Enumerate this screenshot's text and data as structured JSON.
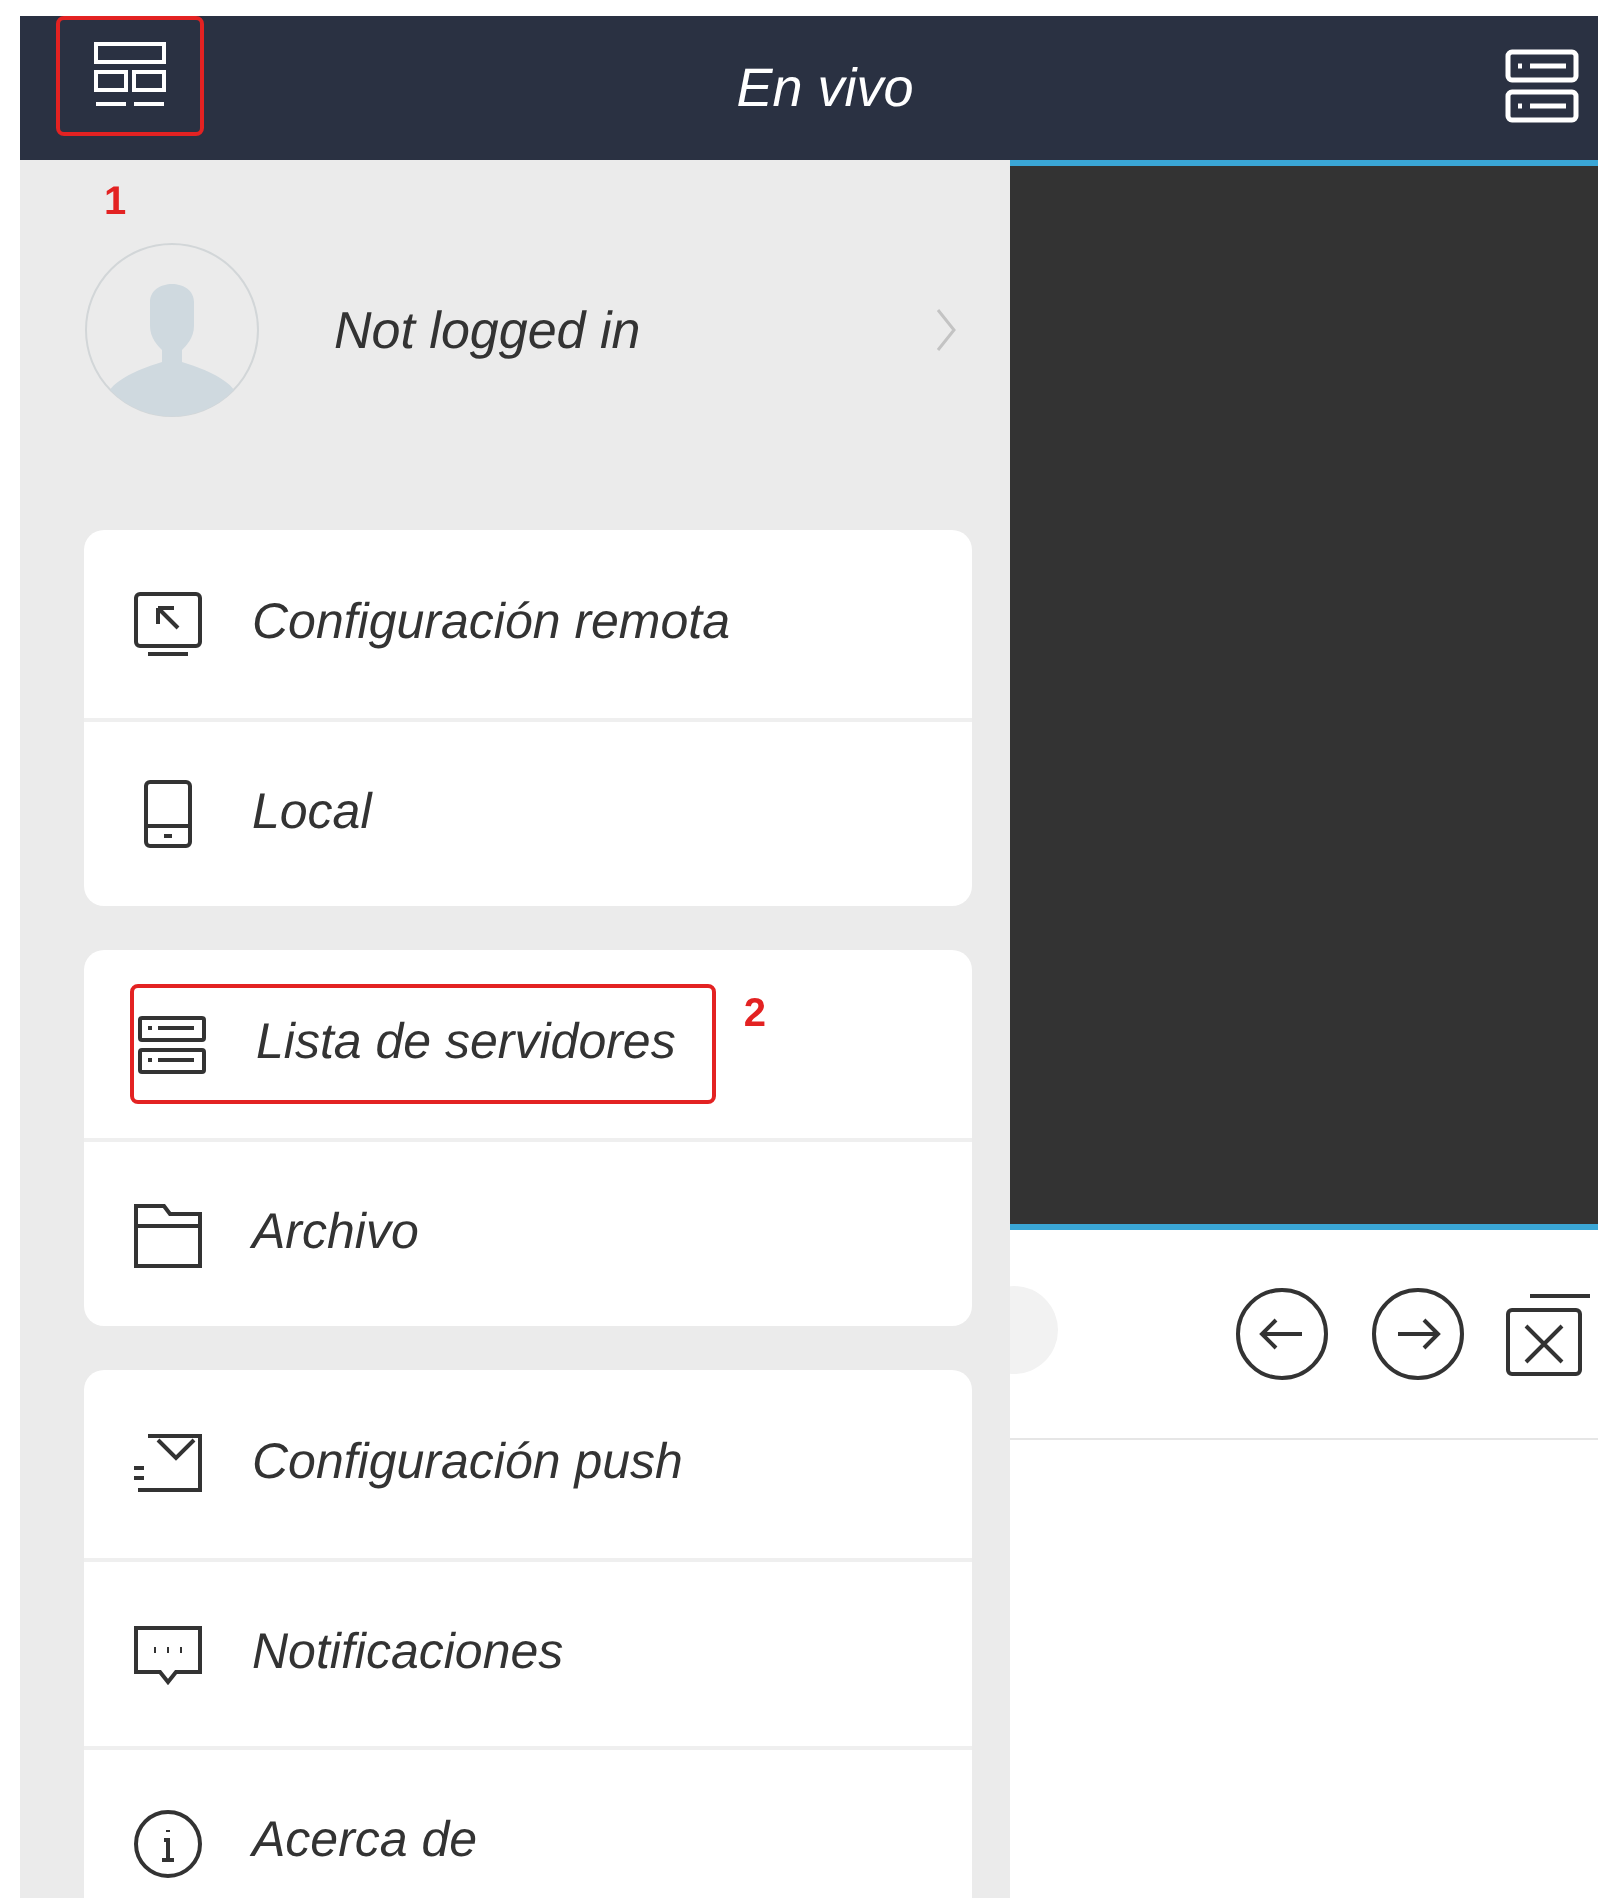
{
  "top_bar": {
    "title": "En vivo",
    "annotation": "1"
  },
  "profile": {
    "name": "Not logged in"
  },
  "menu_groups": [
    {
      "items": [
        {
          "kind": "remote",
          "label": "Configuración remota"
        },
        {
          "kind": "local",
          "label": "Local"
        }
      ]
    },
    {
      "items": [
        {
          "kind": "servers",
          "label": "Lista de servidores",
          "annotation": "2"
        },
        {
          "kind": "files",
          "label": "Archivo"
        }
      ]
    },
    {
      "items": [
        {
          "kind": "push",
          "label": "Configuración push"
        },
        {
          "kind": "messages",
          "label": "Notificaciones"
        },
        {
          "kind": "about",
          "label": "Acerca de"
        }
      ]
    }
  ]
}
